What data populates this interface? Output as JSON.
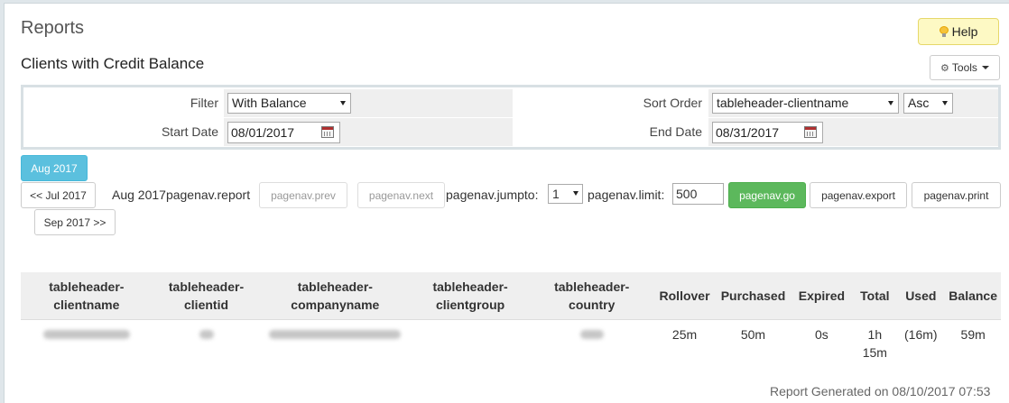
{
  "page": {
    "title": "Reports",
    "subtitle": "Clients with Credit Balance"
  },
  "header": {
    "help_label": "Help",
    "tools_label": "Tools"
  },
  "filters": {
    "filter_label": "Filter",
    "filter_value": "With Balance",
    "sort_label": "Sort Order",
    "sort_value": "tableheader-clientname",
    "sort_dir": "Asc",
    "start_label": "Start Date",
    "start_value": "08/01/2017",
    "end_label": "End Date",
    "end_value": "08/31/2017"
  },
  "pagenav": {
    "current_month": "Aug 2017",
    "prev_month": "<< Jul 2017",
    "next_month": "Sep 2017 >>",
    "report_text": "Aug 2017pagenav.report",
    "prev": "pagenav.prev",
    "next": "pagenav.next",
    "jumpto_label": "pagenav.jumpto:",
    "jumpto_value": "1",
    "limit_label": "pagenav.limit:",
    "limit_value": "500",
    "go": "pagenav.go",
    "export": "pagenav.export",
    "print": "pagenav.print"
  },
  "table": {
    "headers": [
      "tableheader-clientname",
      "tableheader-clientid",
      "tableheader-companyname",
      "tableheader-clientgroup",
      "tableheader-country",
      "Rollover",
      "Purchased",
      "Expired",
      "Total",
      "Used",
      "Balance"
    ],
    "rows": [
      {
        "rollover": "25m",
        "purchased": "50m",
        "expired": "0s",
        "total": "1h 15m",
        "used": "(16m)",
        "balance": "59m"
      }
    ]
  },
  "footer": {
    "generated": "Report Generated on 08/10/2017 07:53"
  },
  "colors": {
    "go": "#5cb85c",
    "month": "#5bc0de",
    "help": "#fdf9c4",
    "negative": "#dd2222"
  }
}
